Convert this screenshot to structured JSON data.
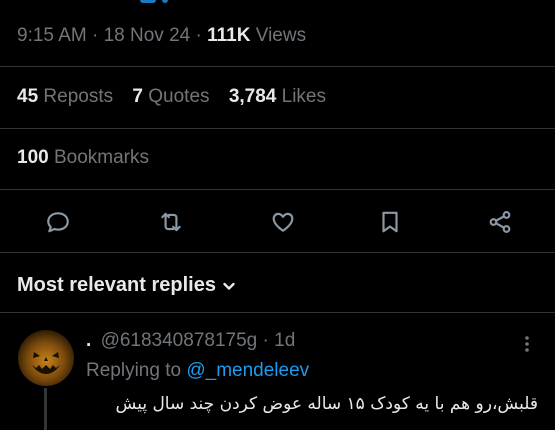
{
  "colors": {
    "background": "#000000",
    "text": "#e7e9ea",
    "muted": "#71767b",
    "accent": "#1d9bf0",
    "divider": "#2f3336",
    "icon": "#8b98a5"
  },
  "tweet": {
    "time": "9:15 AM",
    "sep1": "·",
    "date": "18 Nov 24",
    "sep2": "·",
    "views_count": "111K",
    "views_label": "Views"
  },
  "stats": [
    {
      "count": "45",
      "label": "Reposts"
    },
    {
      "count": "7",
      "label": "Quotes"
    },
    {
      "count": "3,784",
      "label": "Likes"
    }
  ],
  "bookmarks": {
    "count": "100",
    "label": "Bookmarks"
  },
  "actions": [
    {
      "icon": "reply-icon"
    },
    {
      "icon": "repost-icon"
    },
    {
      "icon": "like-icon"
    },
    {
      "icon": "bookmark-icon"
    },
    {
      "icon": "share-icon"
    }
  ],
  "replies_header": {
    "label": "Most relevant replies",
    "icon": "chevron-down-icon"
  },
  "reply": {
    "display_name": ".",
    "handle": "@618340878175g",
    "sep": "·",
    "age": "1d",
    "replying_prefix": "Replying to",
    "replying_to": "@_mendeleev",
    "text": "قلبش،رو هم با یه کودک ۱۵ ساله عوض کردن چند سال پیش",
    "more_icon": "more-vertical-icon",
    "avatar": "pumpkin-avatar"
  }
}
